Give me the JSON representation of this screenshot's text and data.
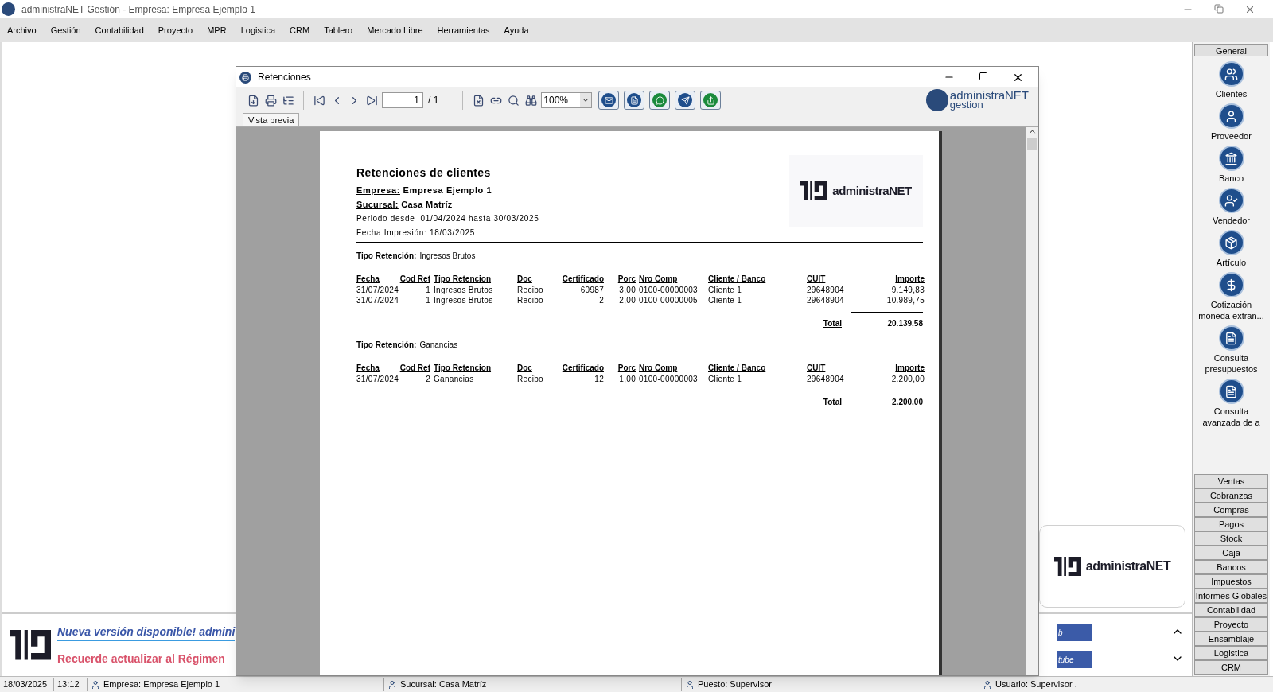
{
  "app": {
    "title": "administraNET Gestión - Empresa: Empresa Ejemplo 1"
  },
  "menu": [
    "Archivo",
    "Gestión",
    "Contabilidad",
    "Proyecto",
    "MPR",
    "Logistica",
    "CRM",
    "Tablero",
    "Mercado Libre",
    "Herramientas",
    "Ayuda"
  ],
  "window": {
    "title": "Retenciones",
    "page_input": "1",
    "page_total": "/ 1",
    "zoom": "100%",
    "tab": "Vista previa",
    "logo_top": "administraNET",
    "logo_bottom": "gestion"
  },
  "report": {
    "title": "Retenciones de clientes",
    "empresa_label": "Empresa:",
    "empresa": "Empresa Ejemplo 1",
    "sucursal_label": "Sucursal:",
    "sucursal": "Casa Matríz",
    "periodo": "Periodo desde  01/04/2024 hasta 30/03/2025",
    "fecha": "Fecha Impresión: 18/03/2025",
    "logo": "administraNET",
    "sections": [
      {
        "label": "Tipo Retención:",
        "value": "Ingresos Brutos",
        "columns": [
          "Fecha",
          "Cod Ret",
          "Tipo Retencion",
          "Doc",
          "Certificado",
          "Porc",
          "Nro Comp",
          "Cliente / Banco",
          "CUIT",
          "Importe"
        ],
        "rows": [
          [
            "31/07/2024",
            "1",
            "Ingresos Brutos",
            "Recibo",
            "60987",
            "3,00",
            "0100-00000003",
            "Cliente 1",
            "29648904",
            "9.149,83"
          ],
          [
            "31/07/2024",
            "1",
            "Ingresos Brutos",
            "Recibo",
            "2",
            "2,00",
            "0100-00000005",
            "Cliente 1",
            "29648904",
            "10.989,75"
          ]
        ],
        "total_label": "Total",
        "total": "20.139,58"
      },
      {
        "label": "Tipo Retención:",
        "value": "Ganancias",
        "columns": [
          "Fecha",
          "Cod Ret",
          "Tipo Retencion",
          "Doc",
          "Certificado",
          "Porc",
          "Nro Comp",
          "Cliente / Banco",
          "CUIT",
          "Importe"
        ],
        "rows": [
          [
            "31/07/2024",
            "2",
            "Ganancias",
            "Recibo",
            "12",
            "1,00",
            "0100-00000003",
            "Cliente 1",
            "29648904",
            "2.200,00"
          ]
        ],
        "total_label": "Total",
        "total": "2.200,00"
      }
    ]
  },
  "sidebar": {
    "header": "General",
    "items": [
      {
        "label": "Clientes",
        "kind": "users"
      },
      {
        "label": "Proveedor",
        "kind": "supplier"
      },
      {
        "label": "Banco",
        "kind": "bank"
      },
      {
        "label": "Vendedor",
        "kind": "seller"
      },
      {
        "label": "Artículo",
        "kind": "box"
      },
      {
        "label": "Cotización moneda extran...",
        "kind": "dollar"
      },
      {
        "label": "Consulta presupuestos",
        "kind": "doc"
      },
      {
        "label": "Consulta avanzada de a",
        "kind": "doc"
      }
    ],
    "groups": [
      "Ventas",
      "Cobranzas",
      "Compras",
      "Pagos",
      "Stock",
      "Caja",
      "Bancos",
      "Impuestos",
      "Informes Globales",
      "Contabilidad",
      "Proyecto",
      "Ensamblaje",
      "Logistica",
      "CRM"
    ]
  },
  "banner": {
    "headline": "Nueva versión disponible! admini",
    "reminder": "Recuerde actualizar al Régimen"
  },
  "desktop": {
    "logo": "administraNET",
    "buttons": [
      "b",
      "tube"
    ]
  },
  "status": {
    "date": "18/03/2025",
    "time": "13:12",
    "empresa": "Empresa: Empresa Ejemplo 1",
    "sucursal": "Sucursal: Casa Matríz",
    "puesto": "Puesto: Supervisor",
    "usuario": "Usuario: Supervisor ."
  }
}
